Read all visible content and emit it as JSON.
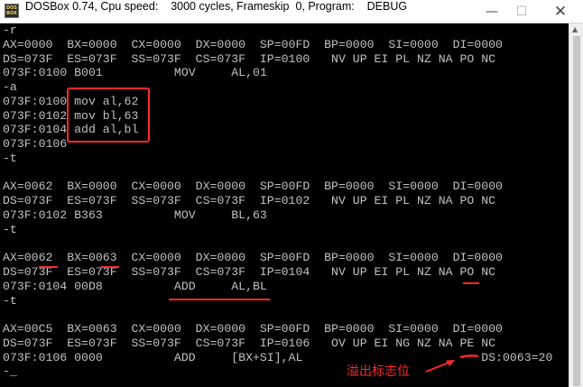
{
  "window": {
    "title": "DOSBox 0.74, Cpu speed:    3000 cycles, Frameskip  0, Program:    DEBUG",
    "icon_top": "DOS",
    "icon_bottom": "BOX",
    "minimize_glyph": "—",
    "maximize_glyph": "☐",
    "close_glyph": "✕"
  },
  "console": {
    "lines": [
      "-r",
      "AX=0000  BX=0000  CX=0000  DX=0000  SP=00FD  BP=0000  SI=0000  DI=0000",
      "DS=073F  ES=073F  SS=073F  CS=073F  IP=0100   NV UP EI PL NZ NA PO NC",
      "073F:0100 B001          MOV     AL,01",
      "-a",
      "073F:0100 mov al,62",
      "073F:0102 mov bl,63",
      "073F:0104 add al,bl",
      "073F:0106",
      "-t",
      "",
      "AX=0062  BX=0000  CX=0000  DX=0000  SP=00FD  BP=0000  SI=0000  DI=0000",
      "DS=073F  ES=073F  SS=073F  CS=073F  IP=0102   NV UP EI PL NZ NA PO NC",
      "073F:0102 B363          MOV     BL,63",
      "-t",
      "",
      "AX=0062  BX=0063  CX=0000  DX=0000  SP=00FD  BP=0000  SI=0000  DI=0000",
      "DS=073F  ES=073F  SS=073F  CS=073F  IP=0104   NV UP EI PL NZ NA PO NC",
      "073F:0104 00D8          ADD     AL,BL",
      "-t",
      "",
      "AX=00C5  BX=0063  CX=0000  DX=0000  SP=00FD  BP=0000  SI=0000  DI=0000",
      "DS=073F  ES=073F  SS=073F  CS=073F  IP=0106   OV UP EI NG NZ NA PE NC",
      "073F:0106 0000          ADD     [BX+SI],AL                         DS:0063=20",
      "-_"
    ]
  },
  "annotation": {
    "text": "溢出标志位"
  },
  "colors": {
    "console_bg": "#000000",
    "console_text": "#c0c0c0",
    "annotation_red": "#ff2a2a",
    "titlebar_bg": "#ffffff"
  }
}
